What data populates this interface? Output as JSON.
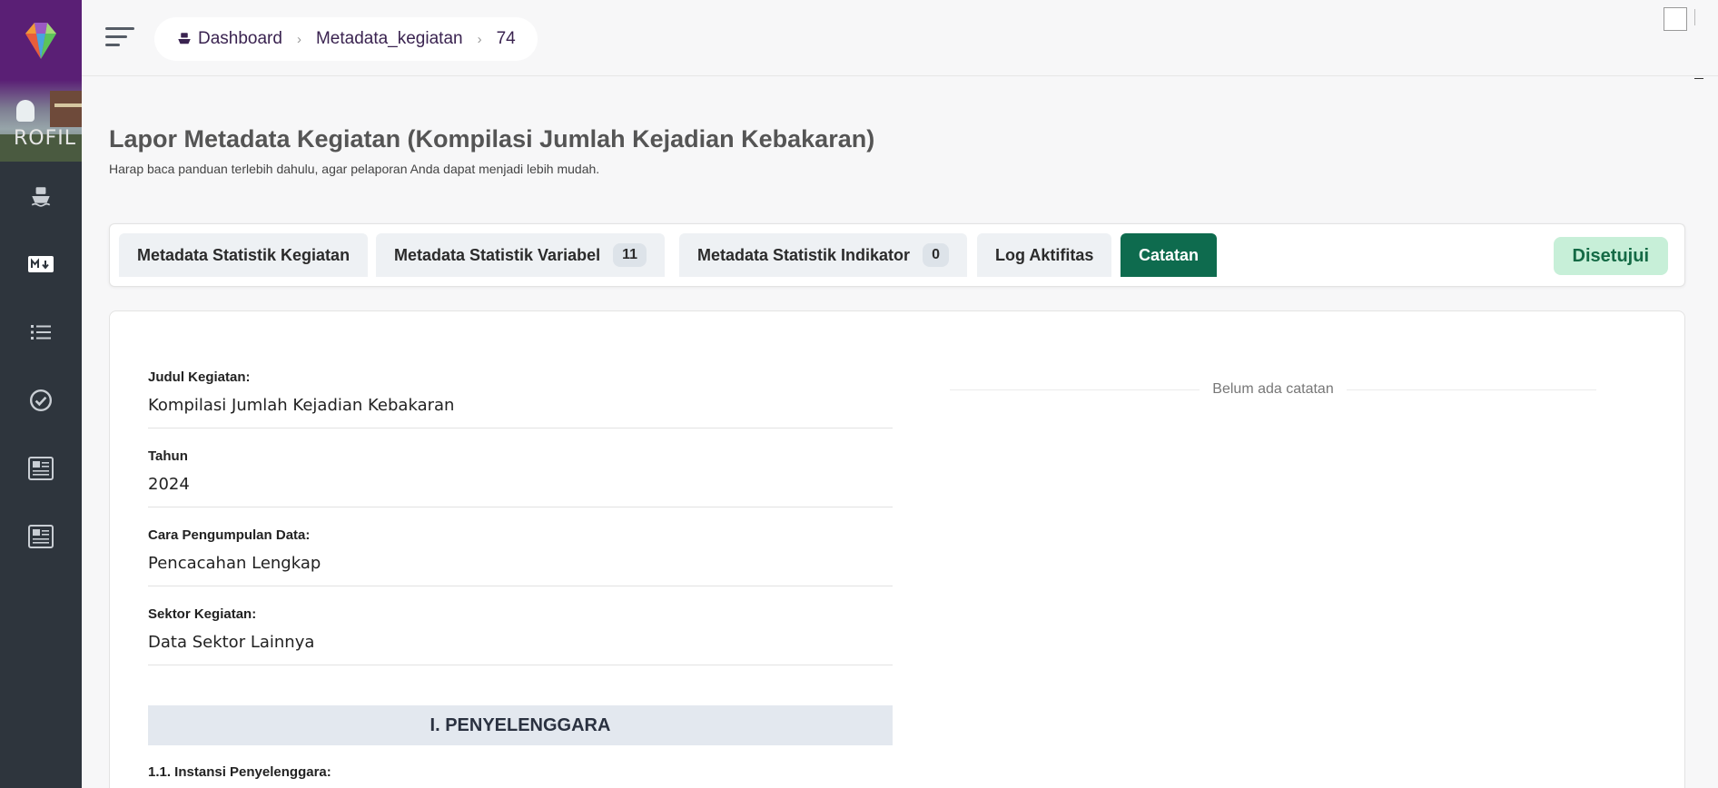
{
  "breadcrumb": {
    "dashboard": "Dashboard",
    "section": "Metadata_kegiatan",
    "id": "74"
  },
  "sidebar": {
    "banner_text": "ROFIL",
    "items": [
      {
        "icon": "ship-icon"
      },
      {
        "icon": "markdown-icon"
      },
      {
        "icon": "list-icon"
      },
      {
        "icon": "check-circle-icon"
      },
      {
        "icon": "newspaper-icon"
      },
      {
        "icon": "newspaper-icon"
      }
    ]
  },
  "page": {
    "title": "Lapor Metadata Kegiatan (Kompilasi Jumlah Kejadian Kebakaran)",
    "subtitle": "Harap baca panduan terlebih dahulu, agar pelaporan Anda dapat menjadi lebih mudah."
  },
  "tabs": [
    {
      "label": "Metadata Statistik Kegiatan",
      "badge": ""
    },
    {
      "label": "Metadata Statistik Variabel",
      "badge": "11"
    },
    {
      "label": "Metadata Statistik Indikator",
      "badge": "0"
    },
    {
      "label": "Log Aktifitas",
      "badge": ""
    },
    {
      "label": "Catatan",
      "badge": "",
      "active": true
    }
  ],
  "status": {
    "label": "Disetujui",
    "color": "#c7efd8"
  },
  "fields": [
    {
      "label": "Judul Kegiatan:",
      "value": "Kompilasi Jumlah Kejadian Kebakaran"
    },
    {
      "label": "Tahun",
      "value": "2024"
    },
    {
      "label": "Cara Pengumpulan Data:",
      "value": "Pencacahan Lengkap"
    },
    {
      "label": "Sektor Kegiatan:",
      "value": "Data Sektor Lainnya"
    }
  ],
  "section": {
    "title": "I. PENYELENGGARA",
    "first_field_label": "1.1. Instansi Penyelenggara:"
  },
  "notes": {
    "empty_text": "Belum ada catatan"
  },
  "colors": {
    "sidebar": "#2e353d",
    "brand": "#5a1f75",
    "active_tab": "#0e6b4e"
  }
}
